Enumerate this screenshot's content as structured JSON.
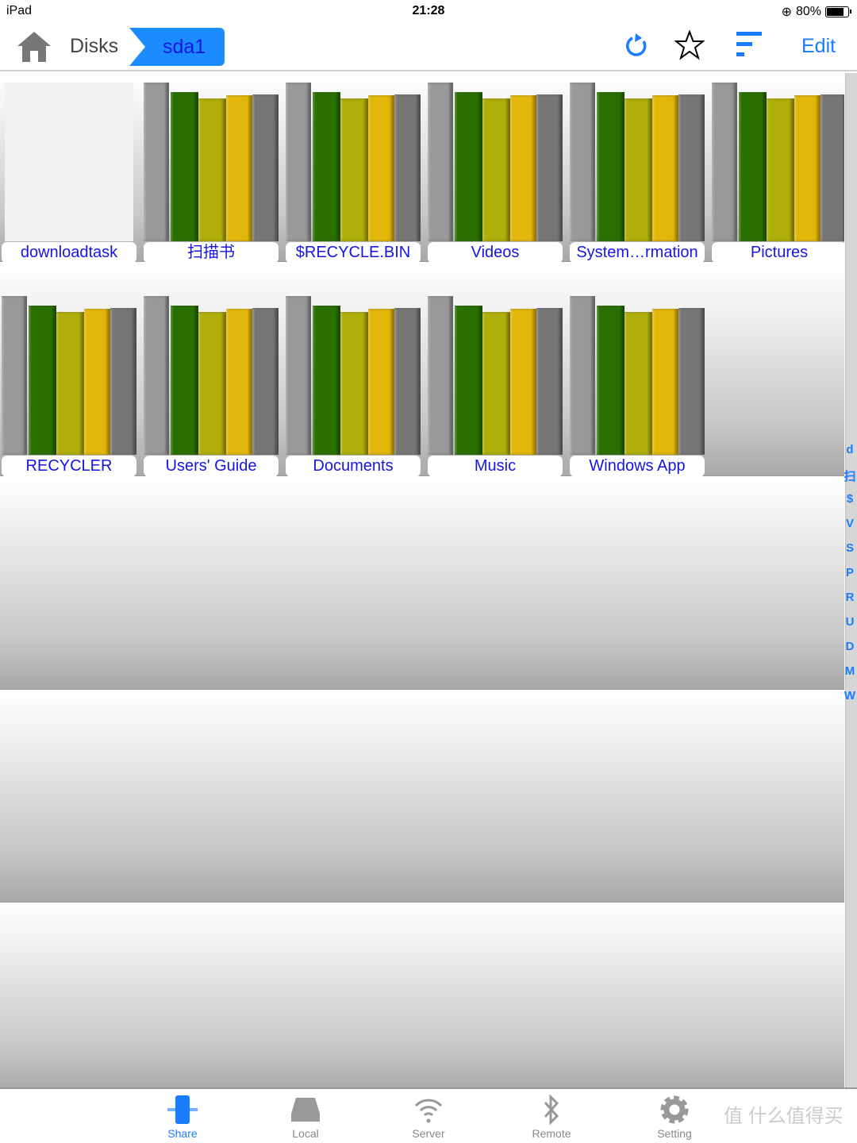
{
  "status": {
    "device": "iPad",
    "time": "21:28",
    "battery": "80%",
    "battery_level": 0.8
  },
  "nav": {
    "root": "Disks",
    "current": "sda1",
    "edit": "Edit"
  },
  "colors": {
    "accent": "#1a7cff",
    "label": "#1515e6",
    "books": [
      "#999999",
      "#2a7000",
      "#b0ae0a",
      "#e2b60a",
      "#767676"
    ]
  },
  "folders": [
    {
      "name": "downloadtask",
      "blank": true
    },
    {
      "name": "扫描书"
    },
    {
      "name": "$RECYCLE.BIN"
    },
    {
      "name": "Videos"
    },
    {
      "name": "System…rmation"
    },
    {
      "name": "Pictures"
    },
    {
      "name": "RECYCLER"
    },
    {
      "name": "Users' Guide"
    },
    {
      "name": "Documents"
    },
    {
      "name": "Music"
    },
    {
      "name": "Windows App"
    }
  ],
  "index": [
    "d",
    "扫",
    "$",
    "V",
    "S",
    "P",
    "R",
    "U",
    "D",
    "M",
    "W"
  ],
  "tabs": [
    {
      "label": "Share",
      "icon": "share-icon",
      "active": true
    },
    {
      "label": "Local",
      "icon": "disk-icon"
    },
    {
      "label": "Server",
      "icon": "wifi-icon"
    },
    {
      "label": "Remote",
      "icon": "bluetooth-icon"
    },
    {
      "label": "Setting",
      "icon": "gear-icon"
    }
  ],
  "watermark": "值 什么值得买"
}
